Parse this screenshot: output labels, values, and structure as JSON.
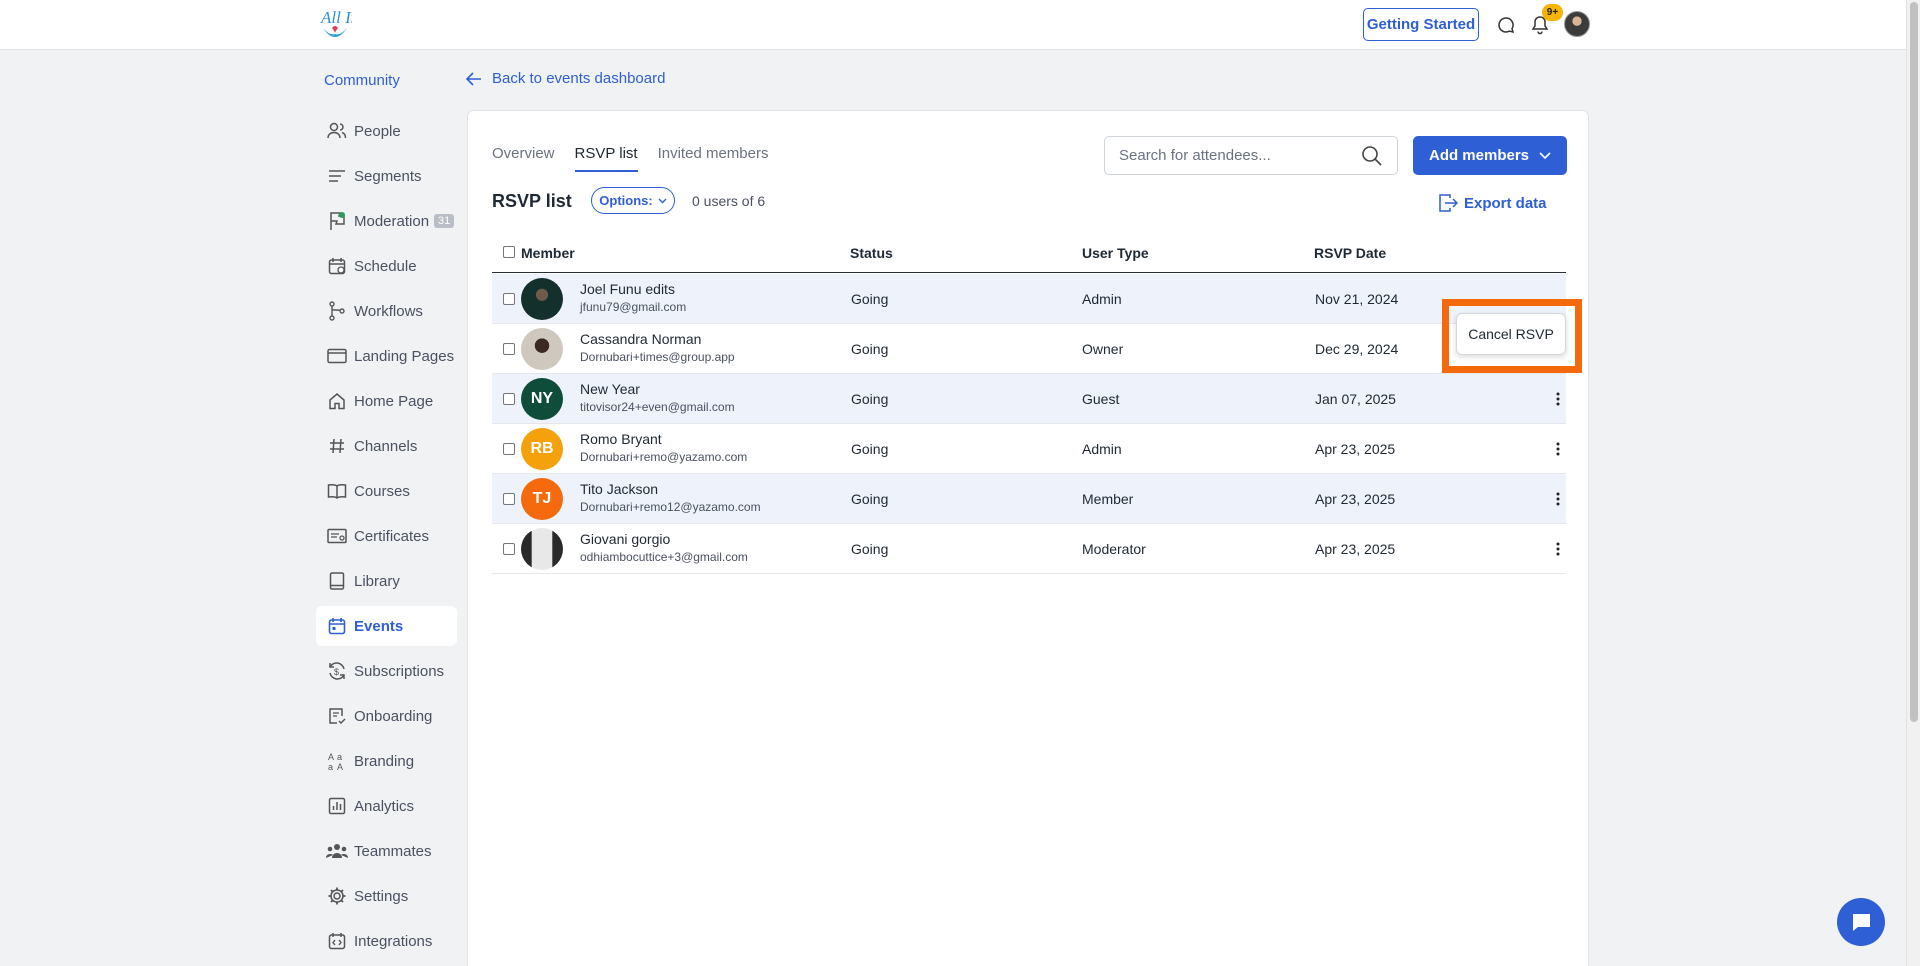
{
  "header": {
    "getting_started": "Getting Started",
    "notification_badge": "9+"
  },
  "sidebar": {
    "community": "Community",
    "items": [
      {
        "label": "People",
        "icon": "people-icon"
      },
      {
        "label": "Segments",
        "icon": "segments-icon"
      },
      {
        "label": "Moderation",
        "icon": "moderation-flag-icon",
        "count": "31"
      },
      {
        "label": "Schedule",
        "icon": "schedule-calendar-icon"
      },
      {
        "label": "Workflows",
        "icon": "workflows-icon"
      },
      {
        "label": "Landing Pages",
        "icon": "landing-pages-icon"
      },
      {
        "label": "Home Page",
        "icon": "home-icon"
      },
      {
        "label": "Channels",
        "icon": "hash-icon"
      },
      {
        "label": "Courses",
        "icon": "book-open-icon"
      },
      {
        "label": "Certificates",
        "icon": "certificate-icon"
      },
      {
        "label": "Library",
        "icon": "library-book-icon"
      },
      {
        "label": "Events",
        "icon": "events-calendar-icon",
        "active": true
      },
      {
        "label": "Subscriptions",
        "icon": "subscriptions-icon"
      },
      {
        "label": "Onboarding",
        "icon": "onboarding-icon"
      },
      {
        "label": "Branding",
        "icon": "branding-icon"
      },
      {
        "label": "Analytics",
        "icon": "analytics-icon"
      },
      {
        "label": "Teammates",
        "icon": "teammates-icon"
      },
      {
        "label": "Settings",
        "icon": "gear-icon"
      },
      {
        "label": "Integrations",
        "icon": "integrations-icon"
      }
    ]
  },
  "main": {
    "back_link": "Back to events dashboard",
    "tabs": [
      {
        "label": "Overview"
      },
      {
        "label": "RSVP list",
        "active": true
      },
      {
        "label": "Invited members"
      }
    ],
    "search_placeholder": "Search for attendees...",
    "add_members": "Add members",
    "list_title": "RSVP list",
    "options_label": "Options:",
    "users_count": "0 users of 6",
    "export_label": "Export data",
    "columns": [
      "Member",
      "Status",
      "User Type",
      "RSVP Date"
    ],
    "rows": [
      {
        "name": "Joel Funu edits",
        "email": "jfunu79@gmail.com",
        "status": "Going",
        "user_type": "Admin",
        "date": "Nov 21, 2024",
        "initials": "",
        "avatar_color": "#1d3d38"
      },
      {
        "name": "Cassandra Norman",
        "email": "Dornubari+times@group.app",
        "status": "Going",
        "user_type": "Owner",
        "date": "Dec 29, 2024",
        "initials": "",
        "avatar_color": "#5a4a3f"
      },
      {
        "name": "New Year",
        "email": "titovisor24+even@gmail.com",
        "status": "Going",
        "user_type": "Guest",
        "date": "Jan 07, 2025",
        "initials": "NY",
        "avatar_color": "#0f4d3a"
      },
      {
        "name": "Romo Bryant",
        "email": "Dornubari+remo@yazamo.com",
        "status": "Going",
        "user_type": "Admin",
        "date": "Apr 23, 2025",
        "initials": "RB",
        "avatar_color": "#f4a10b"
      },
      {
        "name": "Tito Jackson",
        "email": "Dornubari+remo12@yazamo.com",
        "status": "Going",
        "user_type": "Member",
        "date": "Apr 23, 2025",
        "initials": "TJ",
        "avatar_color": "#f46a0c"
      },
      {
        "name": "Giovani gorgio",
        "email": "odhiambocuttice+3@gmail.com",
        "status": "Going",
        "user_type": "Moderator",
        "date": "Apr 23, 2025",
        "initials": "",
        "avatar_color": "#3a3a3a"
      }
    ],
    "cancel_rsvp": "Cancel RSVP"
  },
  "colors": {
    "accent": "#2f5fd4",
    "highlight": "#f4690c",
    "row_shaded": "#eef3fb"
  }
}
